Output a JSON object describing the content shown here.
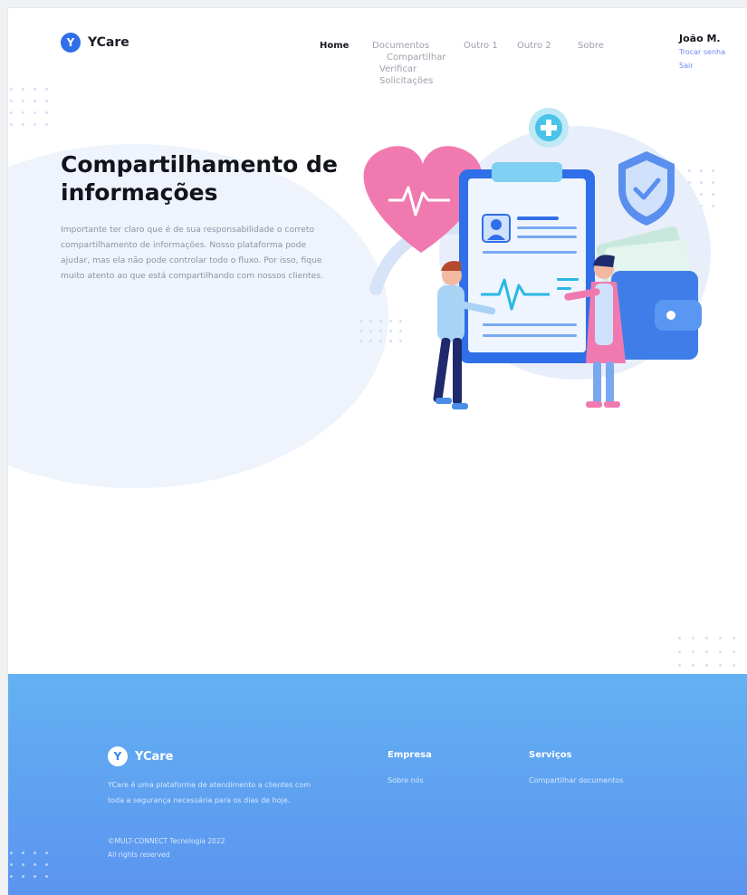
{
  "brand": {
    "name": "YCare",
    "mark": "Y",
    "color": "#2f6fe8"
  },
  "nav": {
    "home": "Home",
    "documentos": "Documentos",
    "documentos_submenu": [
      "Compartilhar",
      "Verificar",
      "Solicitações"
    ],
    "outro1": "Outro 1",
    "outro2": "Outro 2",
    "sobre": "Sobre"
  },
  "user": {
    "name": "João M.",
    "change_password": "Trocar senha",
    "logout": "Sair"
  },
  "hero": {
    "title": "Compartilhamento de informações",
    "text": "Importante ter claro que é de sua responsabilidade o correto compartilhamento de informações. Nosso plataforma pode ajudar, mas ela não pode controlar todo o fluxo. Por isso, fique muito atento ao que está compartilhando com nossos clientes."
  },
  "footer": {
    "brand": "YCare",
    "mark": "Y",
    "description": "YCare é uma plataforma de atendimento a clientes com toda a segurança necessária para os dias de hoje.",
    "copyright": "©MULT-CONNECT Tecnologia 2022",
    "rights": "All rights reserved",
    "empresa_heading": "Empresa",
    "empresa_link": "Sobre nós",
    "servicos_heading": "Serviços",
    "servicos_link": "Compartilhar documentos"
  },
  "colors": {
    "accent": "#2f6fe8",
    "footer_top": "#63b1f2",
    "footer_bottom": "#5b94ef",
    "link": "#6e86f5"
  },
  "icons": [
    "y-logo-icon",
    "heart-pulse-icon",
    "plus-badge-icon",
    "shield-check-icon",
    "wallet-icon",
    "clipboard-icon"
  ]
}
